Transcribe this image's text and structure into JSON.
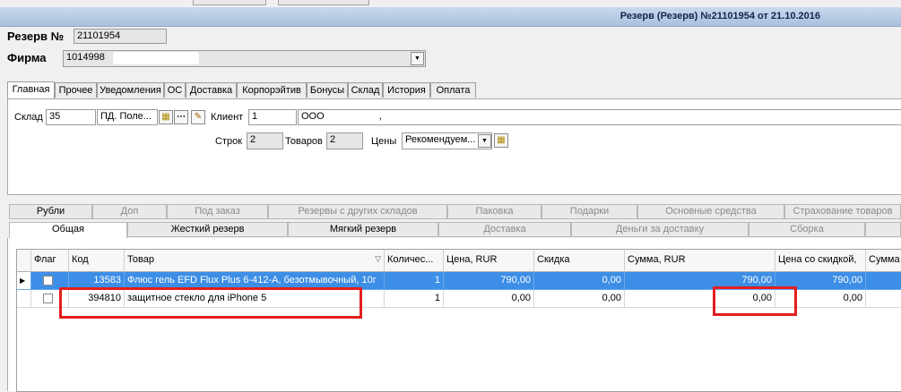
{
  "window": {
    "title": "Резерв (Резерв) №21101954 от 21.10.2016"
  },
  "header": {
    "reserve_label": "Резерв №",
    "reserve_number": "21101954",
    "firm_label": "Фирма",
    "firm_code": "1014998"
  },
  "tabs_main": [
    "Главная",
    "Прочее",
    "Уведомления",
    "ОС",
    "Доставка",
    "Корпорэйтив",
    "Бонусы",
    "Склад",
    "История",
    "Оплата"
  ],
  "main_panel": {
    "sklad_label": "Склад",
    "sklad_code": "35",
    "sklad_name": "ПД. Поле...",
    "client_label": "Клиент",
    "client_code": "1",
    "client_name": "ООО",
    "client_suffix": ",",
    "rows_label": "Строк",
    "rows_value": "2",
    "goods_label": "Товаров",
    "goods_value": "2",
    "prices_label": "Цены",
    "prices_value": "Рекомендуем..."
  },
  "tabs_row1": [
    "Рубли",
    "Доп",
    "Под заказ",
    "Резервы с других складов",
    "Паковка",
    "Подарки",
    "Основные средства",
    "Страхование товаров"
  ],
  "tabs_row2": [
    "Общая",
    "Жесткий резерв",
    "Мягкий резерв",
    "Доставка",
    "Деньги за доставку",
    "Сборка"
  ],
  "grid": {
    "columns": [
      "Флаг",
      "Код",
      "Товар",
      "Количес...",
      "Цена, RUR",
      "Скидка",
      "Сумма, RUR",
      "Цена со скидкой,",
      "Сумма с"
    ],
    "rows": [
      {
        "code": "13583",
        "name": "Флюс гель EFD Flux Plus 6-412-A, безотмывочный, 10г",
        "qty": "1",
        "price": "790,00",
        "discount": "0,00",
        "sum": "790,00",
        "price_disc": "790,00"
      },
      {
        "code": "394810",
        "name": "защитное стекло для iPhone 5",
        "qty": "1",
        "price": "0,00",
        "discount": "0,00",
        "sum": "0,00",
        "price_disc": "0,00"
      }
    ]
  },
  "colors": {
    "selection": "#3d8ee6",
    "highlight": "#e41e1e",
    "title_bar": "#b8cce4"
  },
  "icons": [
    "dropdown-arrow-icon",
    "calendar-icon",
    "ellipsis-icon",
    "edit-icon",
    "sort-icon",
    "row-pointer-icon"
  ]
}
